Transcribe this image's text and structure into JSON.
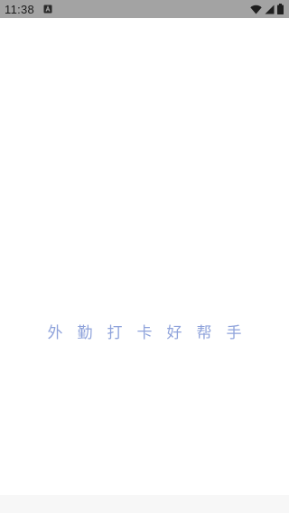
{
  "status_bar": {
    "time": "11:38",
    "icons": [
      "notification-a-icon",
      "wifi-icon",
      "cellular-signal-icon",
      "battery-icon"
    ],
    "background": "#a3a3a3"
  },
  "splash": {
    "slogan": "外勤打卡好帮手",
    "slogan_color": "#8fa3db",
    "background": "#ffffff"
  },
  "nav_bar": {
    "background": "#f7f7f7"
  }
}
